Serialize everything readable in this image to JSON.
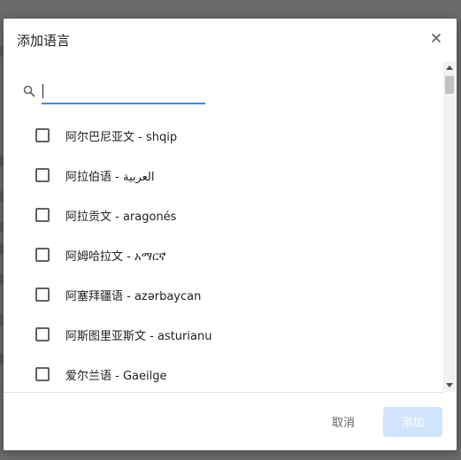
{
  "dialog": {
    "title": "添加语言",
    "search": {
      "value": "",
      "placeholder": ""
    },
    "languages": [
      {
        "label": "阿尔巴尼亚文 - shqip",
        "checked": false
      },
      {
        "label": "阿拉伯语 - العربية",
        "checked": false
      },
      {
        "label": "阿拉贡文 - aragonés",
        "checked": false
      },
      {
        "label": "阿姆哈拉文 - አማርኛ",
        "checked": false
      },
      {
        "label": "阿塞拜疆语 - azərbaycan",
        "checked": false
      },
      {
        "label": "阿斯图里亚斯文 - asturianu",
        "checked": false
      },
      {
        "label": "爱尔兰语 - Gaeilge",
        "checked": false
      }
    ],
    "cancel_label": "取消",
    "add_label": "添加"
  },
  "colors": {
    "accent": "#4285f4",
    "add_button_disabled_bg": "#d2e3fc"
  },
  "icons": [
    "close-icon",
    "search-icon"
  ]
}
